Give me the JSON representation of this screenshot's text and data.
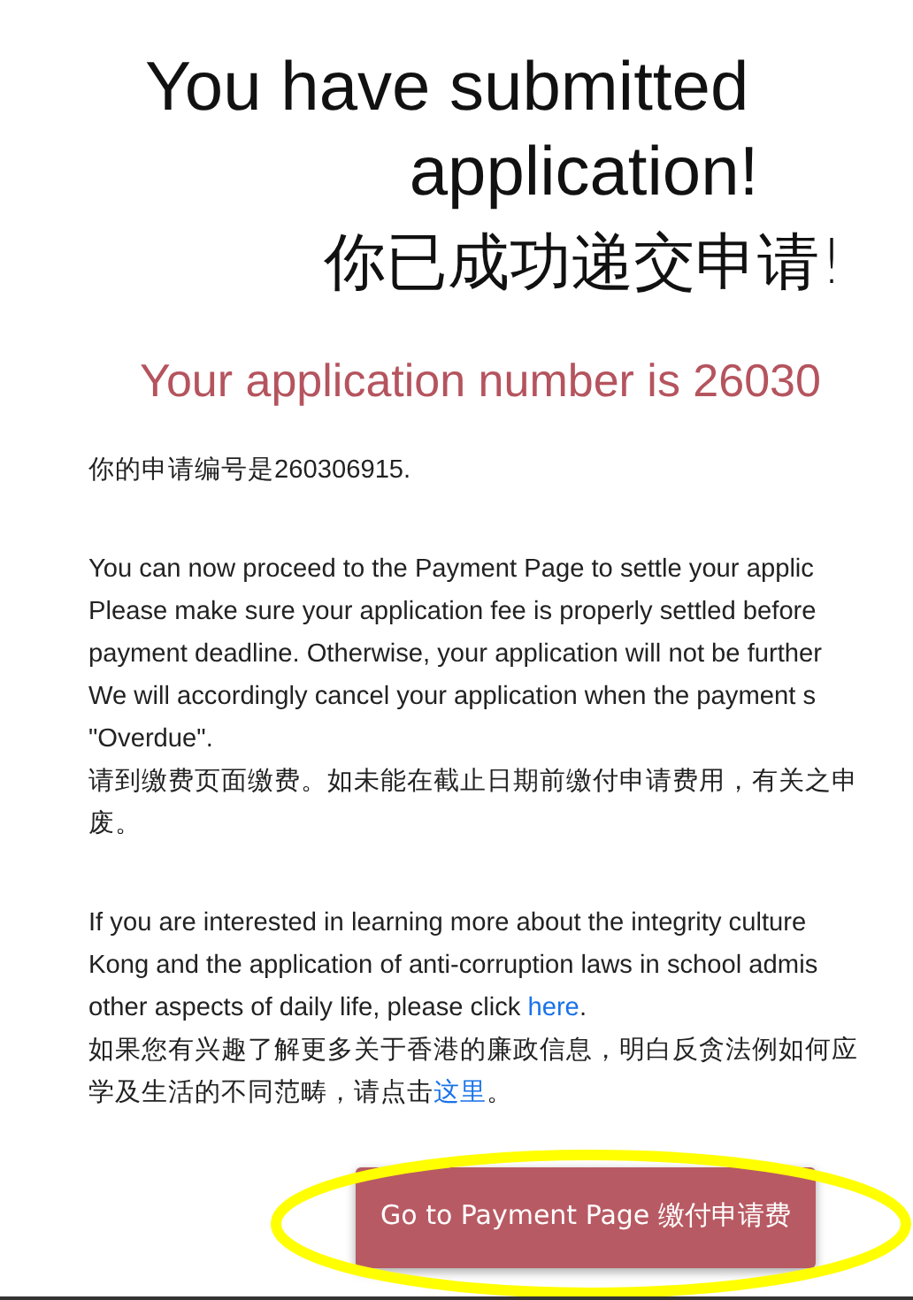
{
  "title": {
    "lines": [
      "You have submitted",
      "application!"
    ],
    "zh": "你已成功递交申请!"
  },
  "application_number": "Your application number is 26030",
  "number_zh": "你的申请编号是260306915.",
  "paragraphs": [
    {
      "lines": [
        [
          {
            "kind": "text",
            "text": "You can now proceed to the Payment Page to settle your applic"
          }
        ],
        [
          {
            "kind": "text",
            "text": "Please make sure your application fee is properly settled before"
          }
        ],
        [
          {
            "kind": "text",
            "text": "payment deadline. Otherwise, your application will not be further"
          }
        ],
        [
          {
            "kind": "text",
            "text": "We will accordingly cancel your application when the payment s"
          }
        ],
        [
          {
            "kind": "text",
            "text": "\"Overdue\"."
          }
        ],
        [
          {
            "kind": "text",
            "text": "请到缴费页面缴费。如未能在截止日期前缴付申请费用，有关之申"
          }
        ],
        [
          {
            "kind": "text",
            "text": "废。"
          }
        ]
      ]
    },
    {
      "lines": [
        [
          {
            "kind": "text",
            "text": "If you are interested in learning more about the integrity culture"
          }
        ],
        [
          {
            "kind": "text",
            "text": "Kong and the application of anti-corruption laws in school admis"
          }
        ],
        [
          {
            "kind": "text",
            "text": "other aspects of daily life, please click "
          },
          {
            "kind": "link",
            "text": "here"
          },
          {
            "kind": "text",
            "text": "."
          }
        ],
        [
          {
            "kind": "text",
            "text": "如果您有兴趣了解更多关于香港的廉政信息，明白反贪法例如何应"
          }
        ],
        [
          {
            "kind": "text",
            "text": "学及生活的不同范畴，请点击"
          },
          {
            "kind": "link",
            "text": "这里"
          },
          {
            "kind": "text",
            "text": "。"
          }
        ]
      ]
    }
  ],
  "payment_button": {
    "label": "Go to Payment Page 缴付申请费",
    "highlighted": true
  }
}
